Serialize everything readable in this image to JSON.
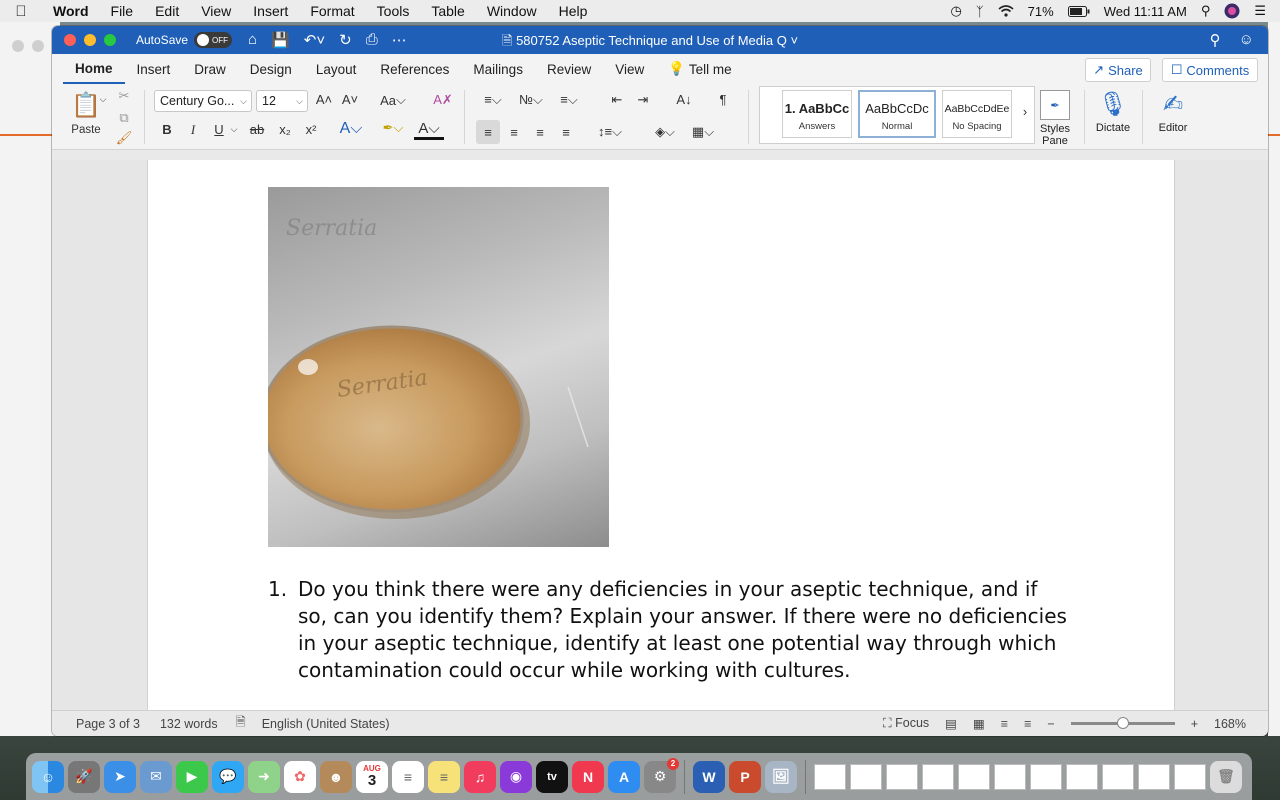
{
  "menubar": {
    "apple_icon": "apple-logo",
    "app_name": "Word",
    "items": [
      "File",
      "Edit",
      "View",
      "Insert",
      "Format",
      "Tools",
      "Table",
      "Window",
      "Help"
    ],
    "battery": "71%",
    "clock": "Wed 11:11 AM"
  },
  "titlebar": {
    "autosave_label": "AutoSave",
    "autosave_state": "OFF",
    "doc_title": "580752 Aseptic Technique and Use of Media Q"
  },
  "tabs": [
    "Home",
    "Insert",
    "Draw",
    "Design",
    "Layout",
    "References",
    "Mailings",
    "Review",
    "View"
  ],
  "tell_me": "Tell me",
  "share_label": "Share",
  "comments_label": "Comments",
  "ribbon": {
    "paste_label": "Paste",
    "font_name": "Century Go...",
    "font_size": "12",
    "aa_label": "Aa",
    "styles": [
      {
        "preview": "1. AaBbCc",
        "name": "Answers"
      },
      {
        "preview": "AaBbCcDc",
        "name": "Normal"
      },
      {
        "preview": "AaBbCcDdEe",
        "name": "No Spacing"
      }
    ],
    "styles_pane_label": "Styles Pane",
    "dictate_label": "Dictate",
    "editor_label": "Editor"
  },
  "document": {
    "photo_alt": "Petri dish culture on metal surface, labeled Serratia",
    "photo_handwriting": [
      "Serratia",
      "Serratia"
    ],
    "questions": [
      {
        "number": "1.",
        "text": "Do you think there were any deficiencies in your aseptic technique, and if so, can you identify them? Explain your answer. If there were no deficiencies in your aseptic technique, identify at least one potential way through which contamination could occur while working with cultures."
      }
    ]
  },
  "statusbar": {
    "page": "Page 3 of 3",
    "words": "132 words",
    "language": "English (United States)",
    "focus": "Focus",
    "zoom": "168%",
    "zoom_level": 0.5
  },
  "dock": {
    "calendar_month": "AUG",
    "calendar_day": "3",
    "sysprefs_badge": "2",
    "appletv_label": "tv"
  }
}
